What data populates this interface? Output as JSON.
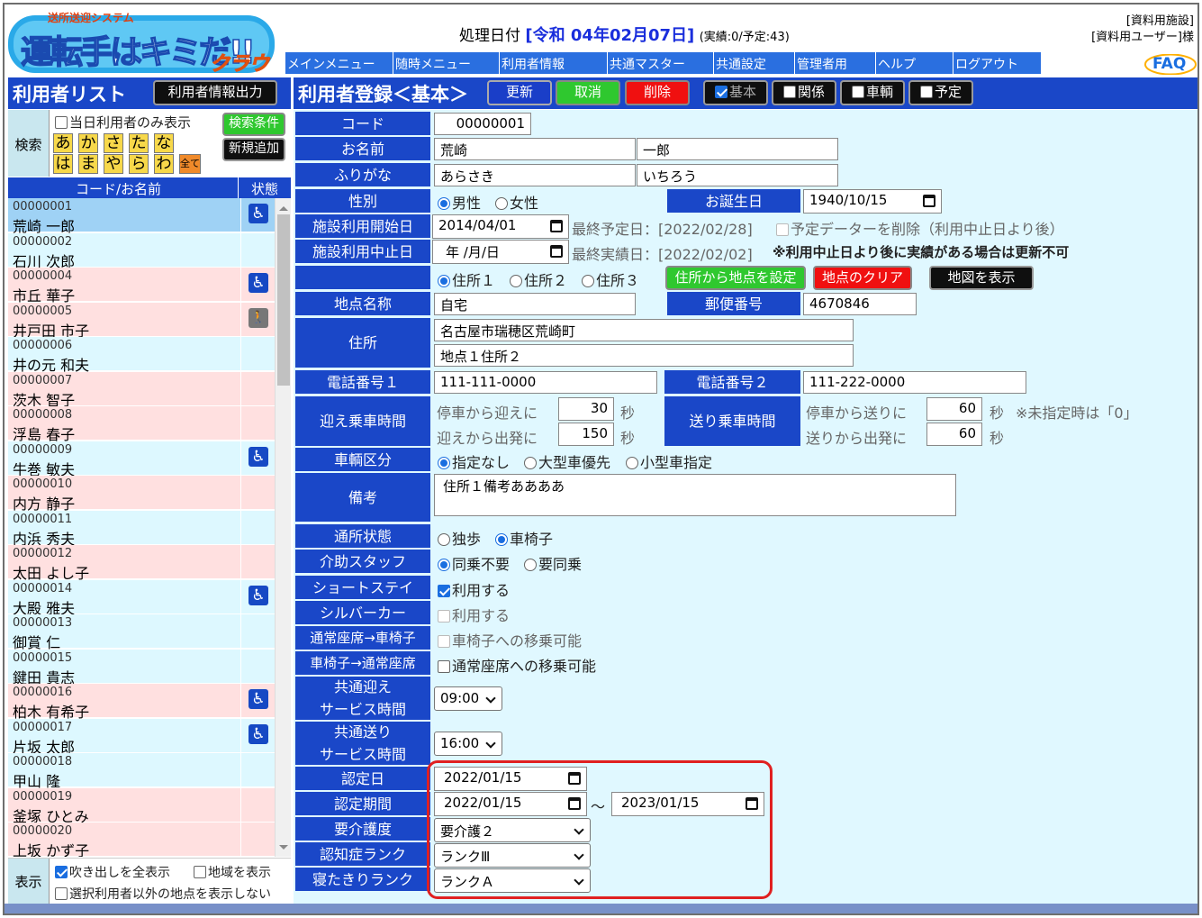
{
  "logo": {
    "top": "送所送迎システム",
    "main": "運転手はキミだ!!",
    "sub": "クラウド"
  },
  "header": {
    "proc_label": "処理日付",
    "proc_date": "[令和 04年02月07日]",
    "proc_stat": "(実績:0/予定:43)",
    "facility": "[資料用施設]",
    "user": "[資料用ユーザー]様",
    "faq": "FAQ"
  },
  "menu": [
    "メインメニュー",
    "随時メニュー",
    "利用者情報",
    "共通マスター",
    "共通設定",
    "管理者用",
    "ヘルプ",
    "ログアウト"
  ],
  "left": {
    "title": "利用者リスト",
    "export_btn": "利用者情報出力",
    "search_label": "検索",
    "today_only": "当日利用者のみ表示",
    "cond_btn": "検索条件",
    "add_btn": "新規追加",
    "kana_row1": [
      "あ",
      "か",
      "さ",
      "た",
      "な"
    ],
    "kana_row2": [
      "は",
      "ま",
      "や",
      "ら",
      "わ",
      "全て"
    ],
    "col_code": "コード/お名前",
    "col_status": "状態",
    "users": [
      {
        "code": "00000001",
        "name": "荒崎 一郎",
        "icon": "wheelchair",
        "bg": "#9fd2f5"
      },
      {
        "code": "00000002",
        "name": "石川 次郎",
        "icon": "",
        "bg": "#ddf8ff"
      },
      {
        "code": "00000004",
        "name": "市丘 華子",
        "icon": "wheelchair",
        "bg": "#ffe0e0"
      },
      {
        "code": "00000005",
        "name": "井戸田 市子",
        "icon": "walker",
        "bg": "#ffe0e0"
      },
      {
        "code": "00000006",
        "name": "井の元 和夫",
        "icon": "",
        "bg": "#ddf8ff"
      },
      {
        "code": "00000007",
        "name": "茨木 智子",
        "icon": "",
        "bg": "#ffe0e0"
      },
      {
        "code": "00000008",
        "name": "浮島 春子",
        "icon": "",
        "bg": "#ffe0e0"
      },
      {
        "code": "00000009",
        "name": "牛巻 敏夫",
        "icon": "wheelchair",
        "bg": "#ddf8ff"
      },
      {
        "code": "00000010",
        "name": "内方 静子",
        "icon": "",
        "bg": "#ffe0e0"
      },
      {
        "code": "00000011",
        "name": "内浜 秀夫",
        "icon": "",
        "bg": "#ddf8ff"
      },
      {
        "code": "00000012",
        "name": "太田 よし子",
        "icon": "",
        "bg": "#ffe0e0"
      },
      {
        "code": "00000014",
        "name": "大殿 雅夫",
        "icon": "wheelchair",
        "bg": "#ddf8ff"
      },
      {
        "code": "00000013",
        "name": "御賞 仁",
        "icon": "",
        "bg": "#ddf8ff"
      },
      {
        "code": "00000015",
        "name": "鍵田 貴志",
        "icon": "",
        "bg": "#ddf8ff"
      },
      {
        "code": "00000016",
        "name": "柏木 有希子",
        "icon": "wheelchair",
        "bg": "#ffe0e0"
      },
      {
        "code": "00000017",
        "name": "片坂 太郎",
        "icon": "wheelchair",
        "bg": "#ddf8ff"
      },
      {
        "code": "00000018",
        "name": "甲山 隆",
        "icon": "",
        "bg": "#ddf8ff"
      },
      {
        "code": "00000019",
        "name": "釜塚 ひとみ",
        "icon": "",
        "bg": "#ffe0e0"
      },
      {
        "code": "00000020",
        "name": "上坂 かず子",
        "icon": "",
        "bg": "#ffe0e0"
      }
    ],
    "display_label": "表示",
    "show_balloon": "吹き出しを全表示",
    "show_area": "地域を表示",
    "show_others": "選択利用者以外の地点を表示しない"
  },
  "right": {
    "title": "利用者登録＜基本＞",
    "update": "更新",
    "cancel": "取消",
    "delete": "削除",
    "tab_basic": "基本",
    "tab_rel": "関係",
    "tab_vehicle": "車輌",
    "tab_plan": "予定",
    "code_label": "コード",
    "code": "00000001",
    "name_label": "お名前",
    "last": "荒崎",
    "first": "一郎",
    "kana_label": "ふりがな",
    "last_kana": "あらさき",
    "first_kana": "いちろう",
    "sex_label": "性別",
    "male": "男性",
    "female": "女性",
    "birth_label": "お誕生日",
    "birth": "1940/10/15",
    "start_label": "施設利用開始日",
    "start": "2014/04/01",
    "last_plan": "最終予定日：[2022/02/28]",
    "del_plan": "予定データーを削除（利用中止日より後）",
    "stop_label": "施設利用中止日",
    "stop": "年 /月/日",
    "last_actual": "最終実績日：[2022/02/02]",
    "stop_note": "※利用中止日より後に実績がある場合は更新不可",
    "addr1": "住所１",
    "addr2": "住所２",
    "addr3": "住所３",
    "set_point": "住所から地点を設定",
    "clear_point": "地点のクリア",
    "show_map": "地図を表示",
    "place_label": "地点名称",
    "place": "自宅",
    "zip_label": "郵便番号",
    "zip": "4670846",
    "address_label": "住所",
    "address1": "名古屋市瑞穂区荒崎町",
    "address2": "地点１住所２",
    "tel1_label": "電話番号１",
    "tel1": "111-111-0000",
    "tel2_label": "電話番号２",
    "tel2": "111-222-0000",
    "pick_label": "迎え乗車時間",
    "pick1": "停車から迎えに",
    "pick1_v": "30",
    "pick2": "迎えから出発に",
    "pick2_v": "150",
    "sec": "秒",
    "drop_label": "送り乗車時間",
    "drop1": "停車から送りに",
    "drop1_v": "60",
    "drop2": "送りから出発に",
    "drop2_v": "60",
    "drop_note": "※未指定時は「0」",
    "veh_label": "車輌区分",
    "veh1": "指定なし",
    "veh2": "大型車優先",
    "veh3": "小型車指定",
    "note_label": "備考",
    "note": "住所１備考ああああ",
    "status_label": "通所状態",
    "walk": "独歩",
    "wheel": "車椅子",
    "staff_label": "介助スタッフ",
    "staff1": "同乗不要",
    "staff2": "要同乗",
    "short_label": "ショートステイ",
    "use": "利用する",
    "silver_label": "シルバーカー",
    "seat2wc_label": "通常座席→車椅子",
    "seat2wc": "車椅子への移乗可能",
    "wc2seat_label": "車椅子→通常座席",
    "wc2seat": "通常座席への移乗可能",
    "cpick_label1": "共通迎え",
    "cpick_label2": "サービス時間",
    "cpick": "09:00",
    "cdrop_label1": "共通送り",
    "cdrop_label2": "サービス時間",
    "cdrop": "16:00",
    "cert_label": "認定日",
    "cert": "2022/01/15",
    "period_label": "認定期間",
    "period_from": "2022/01/15",
    "tilde": "～",
    "period_to": "2023/01/15",
    "care_label": "要介護度",
    "care": "要介護２",
    "dementia_label": "認知症ランク",
    "dementia": "ランクⅢ",
    "bed_label": "寝たきりランク",
    "bed": "ランクＡ"
  }
}
